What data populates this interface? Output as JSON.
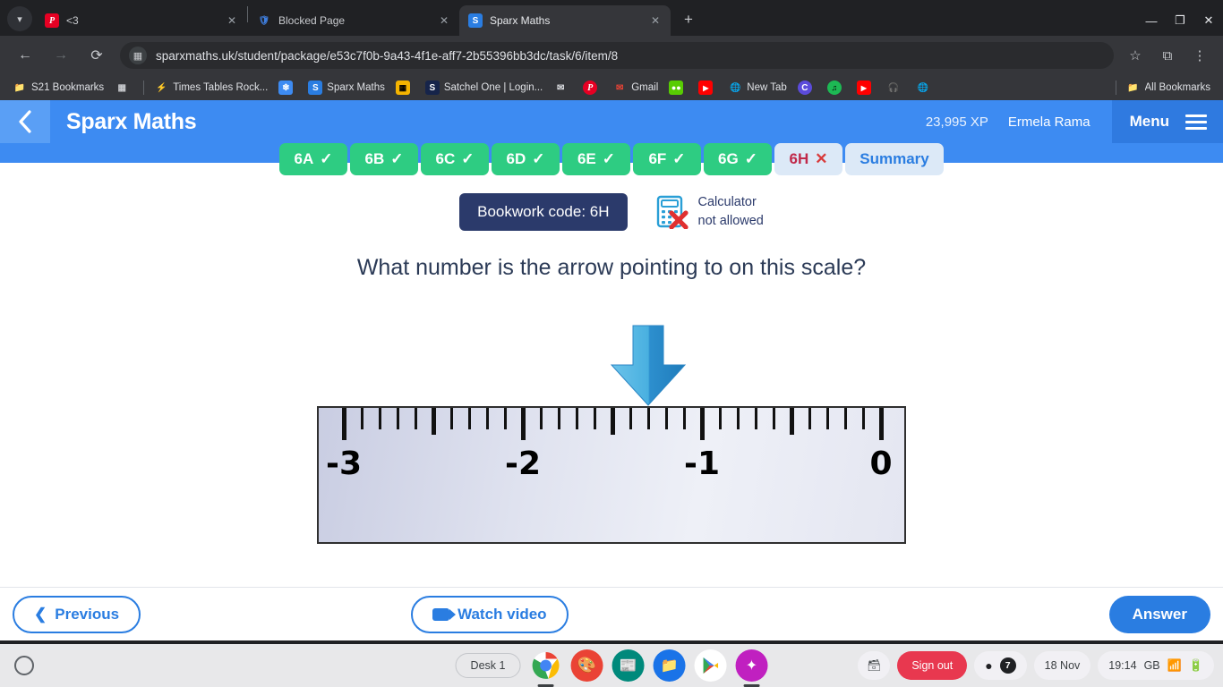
{
  "browser": {
    "tabs": [
      {
        "title": "<3",
        "icon": "pinterest-icon",
        "active": false
      },
      {
        "title": "Blocked Page",
        "icon": "shield-icon",
        "active": false
      },
      {
        "title": "Sparx Maths",
        "icon": "sparx-icon",
        "active": true
      }
    ],
    "new_tab_label": "+",
    "window_controls": {
      "minimize": "—",
      "maximize": "❐",
      "close": "✕"
    },
    "toolbar": {
      "back": "←",
      "forward": "→",
      "reload": "⟳",
      "url": "sparxmaths.uk/student/package/e53c7f0b-9a43-4f1e-aff7-2b55396bb3dc/task/6/item/8",
      "bookmark_star": "☆",
      "extensions": "⧉",
      "menu": "⋮"
    },
    "bookmarks": [
      {
        "label": "S21 Bookmarks",
        "icon": "folder-settings-icon"
      },
      {
        "label": "",
        "icon": "apps-grid-icon"
      },
      {
        "label": "Times Tables Rock...",
        "icon": "ttrockstars-icon"
      },
      {
        "label": "",
        "icon": "snowflake-icon"
      },
      {
        "label": "Sparx Maths",
        "icon": "sparx-icon"
      },
      {
        "label": "",
        "icon": "qr-icon"
      },
      {
        "label": "Satchel One | Login...",
        "icon": "satchel-icon"
      },
      {
        "label": "",
        "icon": "envelope-icon"
      },
      {
        "label": "",
        "icon": "pinterest-icon"
      },
      {
        "label": "Gmail",
        "icon": "gmail-icon"
      },
      {
        "label": "",
        "icon": "duolingo-icon"
      },
      {
        "label": "",
        "icon": "youtube-icon"
      },
      {
        "label": "New Tab",
        "icon": "globe-icon"
      },
      {
        "label": "",
        "icon": "c-circle-icon"
      },
      {
        "label": "",
        "icon": "spotify-icon"
      },
      {
        "label": "",
        "icon": "youtube-icon"
      },
      {
        "label": "",
        "icon": "headphones-icon"
      },
      {
        "label": "",
        "icon": "globe-icon"
      }
    ],
    "all_bookmarks_label": "All Bookmarks"
  },
  "sparx": {
    "back_icon": "chevron-left-icon",
    "title": "Sparx Maths",
    "xp": "23,995 XP",
    "user": "Ermela Rama",
    "menu_label": "Menu",
    "task_tabs": [
      {
        "label": "6A",
        "state": "done",
        "mark": "✓"
      },
      {
        "label": "6B",
        "state": "done",
        "mark": "✓"
      },
      {
        "label": "6C",
        "state": "done",
        "mark": "✓"
      },
      {
        "label": "6D",
        "state": "done",
        "mark": "✓"
      },
      {
        "label": "6E",
        "state": "done",
        "mark": "✓"
      },
      {
        "label": "6F",
        "state": "done",
        "mark": "✓"
      },
      {
        "label": "6G",
        "state": "done",
        "mark": "✓"
      },
      {
        "label": "6H",
        "state": "current",
        "mark": "✕"
      },
      {
        "label": "Summary",
        "state": "summary",
        "mark": ""
      }
    ],
    "bookwork_code": "Bookwork code: 6H",
    "calculator_line1": "Calculator",
    "calculator_line2": "not allowed",
    "question": "What number is the arrow pointing to on this scale?",
    "buttons": {
      "previous": "Previous",
      "watch_video": "Watch video",
      "answer": "Answer"
    }
  },
  "chart_data": {
    "type": "line",
    "title": "Number line scale with arrow",
    "xlabel": "",
    "ylabel": "",
    "xlim": [
      -3,
      0
    ],
    "major_ticks": [
      -3,
      -2,
      -1,
      0
    ],
    "major_tick_labels": [
      "-3",
      "-2",
      "-1",
      "0"
    ],
    "medium_ticks": [
      -2.5,
      -1.5,
      -0.5
    ],
    "minor_tick_step": 0.1,
    "grid": false,
    "legend": "none",
    "annotations": [
      {
        "type": "arrow",
        "label": "down-arrow-marker",
        "x": -1.3,
        "color": "#3d9bdc"
      }
    ]
  },
  "shelf": {
    "launcher_label": "launcher",
    "desk_label": "Desk 1",
    "apps": [
      {
        "name": "chrome-app-icon",
        "running": true
      },
      {
        "name": "canvas-app-icon",
        "running": false
      },
      {
        "name": "news-app-icon",
        "running": false
      },
      {
        "name": "files-app-icon",
        "running": false
      },
      {
        "name": "play-store-app-icon",
        "running": false
      },
      {
        "name": "photos-app-icon",
        "running": true
      }
    ],
    "screen_capture_icon": "screen-capture-icon",
    "sign_out_label": "Sign out",
    "notification_count": "7",
    "date": "18 Nov",
    "time": "19:14",
    "locale": "GB",
    "wifi_icon": "wifi-icon",
    "battery_icon": "battery-icon"
  }
}
